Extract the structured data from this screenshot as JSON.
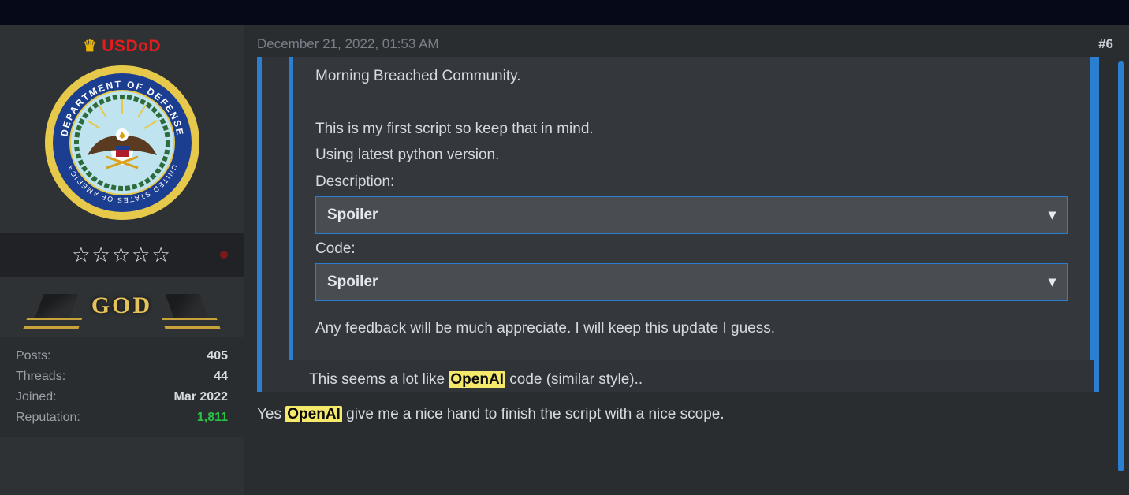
{
  "colors": {
    "highlight_bg": "#f5e96b",
    "highlight_fg": "#0b0b0b",
    "accent_blue": "#2b7fd1",
    "username_red": "#e11d1d",
    "rep_green": "#29c247"
  },
  "user": {
    "name": "USDoD",
    "rank": "GOD",
    "stars": "☆☆☆☆☆",
    "seal_top": "DEPARTMENT OF DEFENSE",
    "seal_bottom": "UNITED STATES OF AMERICA"
  },
  "stats": {
    "posts_label": "Posts:",
    "posts_value": "405",
    "threads_label": "Threads:",
    "threads_value": "44",
    "joined_label": "Joined:",
    "joined_value": "Mar 2022",
    "rep_label": "Reputation:",
    "rep_value": "1,811"
  },
  "post": {
    "timestamp": "December 21, 2022, 01:53 AM",
    "number": "#6",
    "quote": {
      "line1": "Morning Breached Community.",
      "gap": "",
      "line2": "This is my first script so keep that in mind.",
      "line3": "Using latest python version.",
      "desc_label": "Description:",
      "spoiler1_label": "Spoiler",
      "code_label": "Code:",
      "spoiler2_label": "Spoiler",
      "feedback": "Any feedback will be much appreciate. I will keep this update I guess."
    },
    "reply1_pre": "This seems a lot like ",
    "reply1_hl": "OpenAI",
    "reply1_post": " code (similar style)..",
    "reply2_pre": "Yes ",
    "reply2_hl": "OpenAI",
    "reply2_post": " give me a nice hand to finish the script with a nice scope."
  }
}
